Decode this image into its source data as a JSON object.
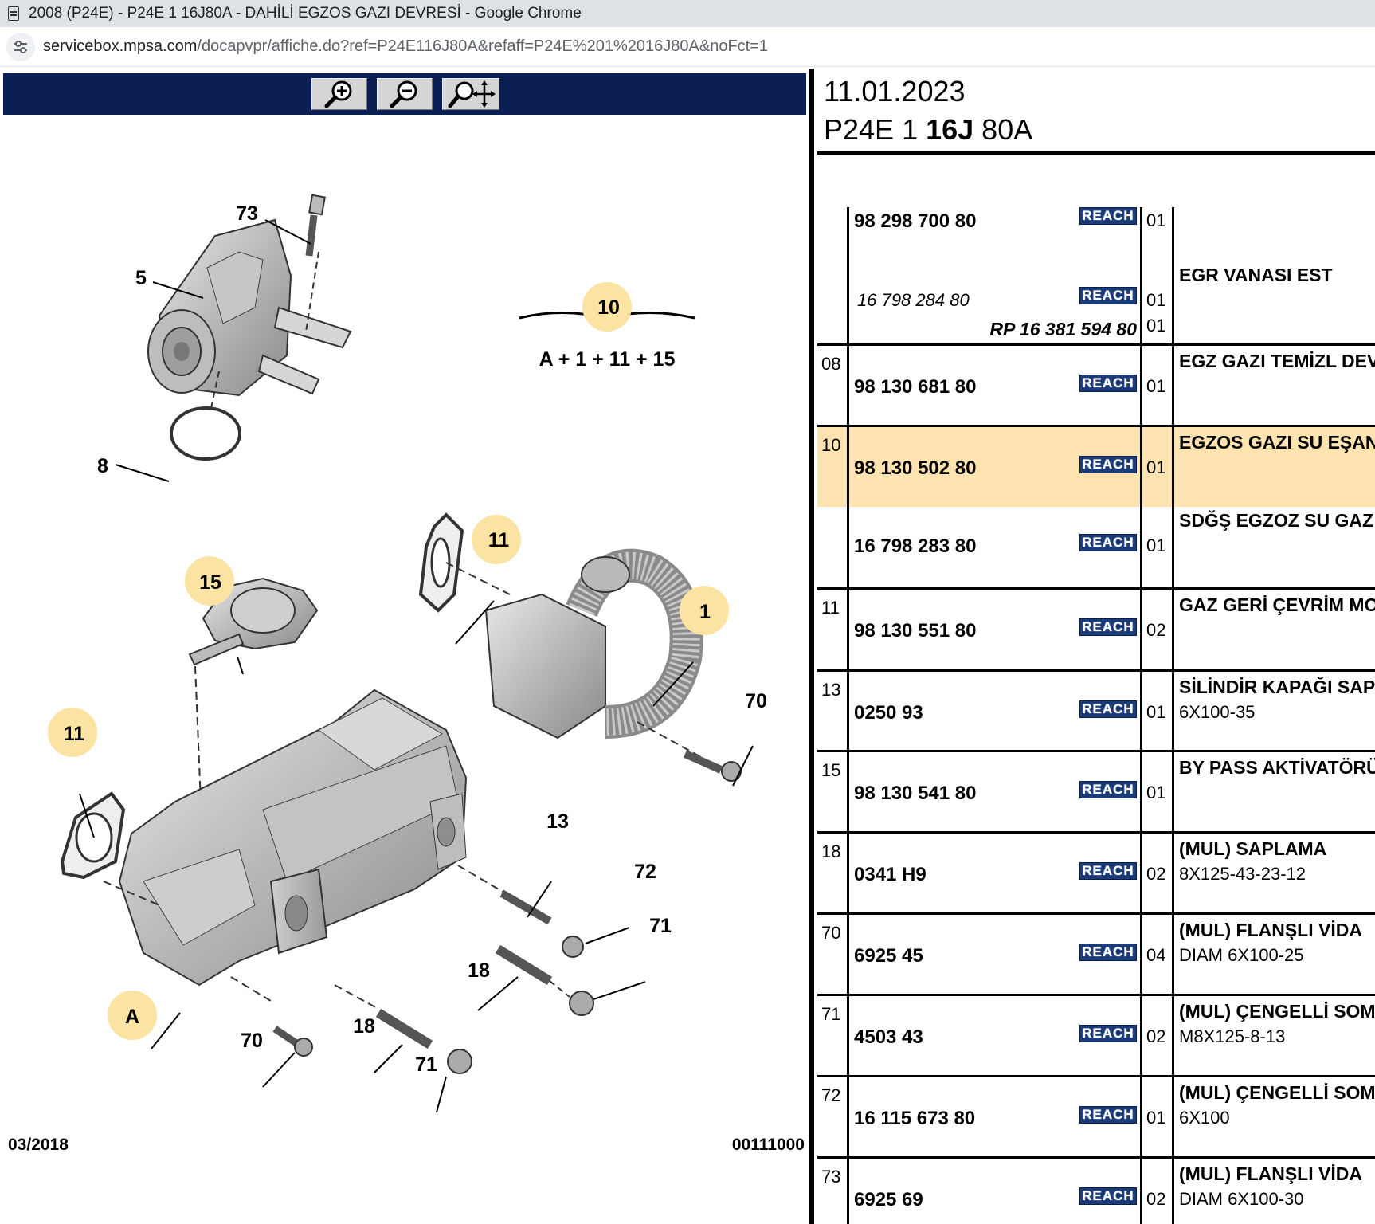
{
  "browser": {
    "window_title": "2008 (P24E) - P24E 1 16J80A - DAHİLİ EGZOS GAZI DEVRESİ - Google Chrome",
    "url_host": "servicebox.mpsa.com",
    "url_path": "/docapvpr/affiche.do?ref=P24E116J80A&refaff=P24E%201%2016J80A&noFct=1"
  },
  "toolbar": {
    "zoom_in_icon": "zoom-in-icon",
    "zoom_out_icon": "zoom-out-icon",
    "pan_zoom_icon": "pan-zoom-icon"
  },
  "diagram": {
    "callouts": [
      "73",
      "5",
      "8",
      "10",
      "11",
      "15",
      "1",
      "70",
      "11",
      "13",
      "72",
      "71",
      "18",
      "A",
      "70",
      "18",
      "71"
    ],
    "kit_formula": "A + 1 + 11 + 15",
    "date_code": "03/2018",
    "figure_code": "00111000",
    "highlight_color": "#fbe3a3"
  },
  "header": {
    "date": "11.01.2023",
    "ref_prefix": "P24E 1 ",
    "ref_bold": "16J",
    "ref_suffix": " 80A"
  },
  "reach_label": "REACH",
  "rows": [
    {
      "ref": "",
      "part": "98 298 700 80",
      "qty": "01",
      "alt": "16 798 284 80",
      "alt_qty": "01",
      "rp": "RP 16 381 594 80",
      "rp_qty": "01",
      "desc": "EGR VANASI EST",
      "desc2": ""
    },
    {
      "ref": "08",
      "part": "98 130 681 80",
      "qty": "01",
      "desc": "EGZ GAZI TEMİZL DEV",
      "desc2": ""
    },
    {
      "ref": "10",
      "part": "98 130 502 80",
      "qty": "01",
      "desc": "EGZOS GAZI SU EŞAN",
      "desc2": "",
      "highlight": true
    },
    {
      "ref": "",
      "part": "16 798 283 80",
      "qty": "01",
      "desc": "SDĞŞ EGZOZ SU GAZ",
      "desc2": ""
    },
    {
      "ref": "11",
      "part": "98 130 551 80",
      "qty": "02",
      "desc": "GAZ GERİ ÇEVRİM MO",
      "desc2": ""
    },
    {
      "ref": "13",
      "part": "0250 93",
      "qty": "01",
      "desc": "SİLİNDİR KAPAĞI SAPL",
      "desc2": "6X100-35"
    },
    {
      "ref": "15",
      "part": "98 130 541 80",
      "qty": "01",
      "desc": "BY PASS AKTİVATÖRÜ",
      "desc2": ""
    },
    {
      "ref": "18",
      "part": "0341 H9",
      "qty": "02",
      "desc": "(MUL) SAPLAMA",
      "desc2": "8X125-43-23-12"
    },
    {
      "ref": "70",
      "part": "6925 45",
      "qty": "04",
      "desc": "(MUL) FLANŞLI VİDA",
      "desc2": "DIAM 6X100-25"
    },
    {
      "ref": "71",
      "part": "4503 43",
      "qty": "02",
      "desc": "(MUL) ÇENGELLİ SOMU",
      "desc2": "M8X125-8-13"
    },
    {
      "ref": "72",
      "part": "16 115 673 80",
      "qty": "01",
      "desc": "(MUL) ÇENGELLİ SOMU",
      "desc2": "6X100"
    },
    {
      "ref": "73",
      "part": "6925 69",
      "qty": "02",
      "desc": "(MUL) FLANŞLI VİDA",
      "desc2": "DIAM 6X100-30"
    }
  ]
}
